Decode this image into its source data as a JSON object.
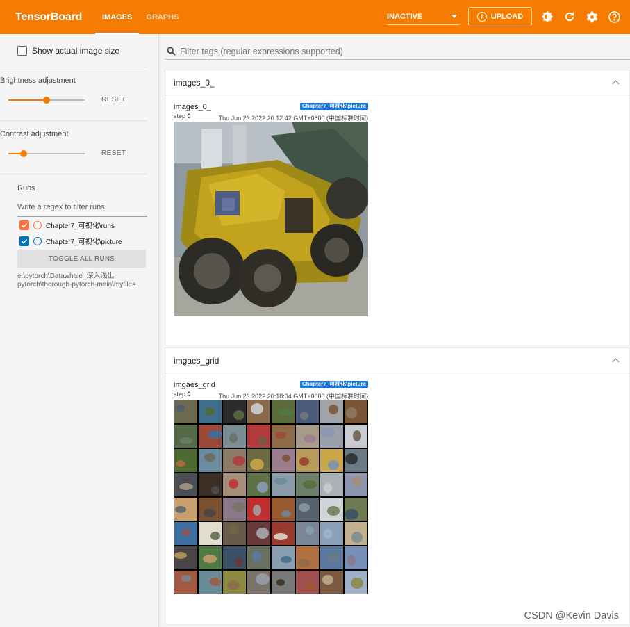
{
  "app": {
    "title": "TensorBoard",
    "tabs": [
      {
        "label": "IMAGES",
        "active": true
      },
      {
        "label": "GRAPHS",
        "active": false
      }
    ],
    "run_select": "INACTIVE",
    "upload_label": "UPLOAD",
    "accent_color": "#f57c00"
  },
  "sidebar": {
    "show_actual_size": "Show actual image size",
    "brightness": {
      "label": "Brightness adjustment",
      "reset": "RESET",
      "value_fraction": 0.5
    },
    "contrast": {
      "label": "Contrast adjustment",
      "reset": "RESET",
      "value_fraction": 0.2
    },
    "runs_title": "Runs",
    "regex_placeholder": "Write a regex to filter runs",
    "runs": [
      {
        "name": "Chapter7_可视化\\runs",
        "color": "#ff7043",
        "checked": true
      },
      {
        "name": "Chapter7_可视化\\picture",
        "color": "#0077bb",
        "checked": true
      }
    ],
    "toggle_all": "TOGGLE ALL RUNS",
    "logdir": "e:\\pytorch\\Datawhale_深入浅出pytorch\\thorough-pytorch-main\\myfiles"
  },
  "main": {
    "filter_placeholder": "Filter tags (regular expressions supported)",
    "cards": [
      {
        "title": "images_0_",
        "tile_name": "images_0_",
        "run_chip": "Chapter7_可视化\\picture",
        "step_label": "step",
        "step_value": "0",
        "timestamp": "Thu Jun 23 2022 20:12:42 GMT+0800 (中国标准时间)"
      },
      {
        "title": "imgaes_grid",
        "tile_name": "imgaes_grid",
        "run_chip": "Chapter7_可视化\\picture",
        "step_label": "step",
        "step_value": "0",
        "timestamp": "Thu Jun 23 2022 20:18:04 GMT+0800 (中国标准时间)"
      }
    ]
  },
  "watermark": "CSDN @Kevin  Davis"
}
